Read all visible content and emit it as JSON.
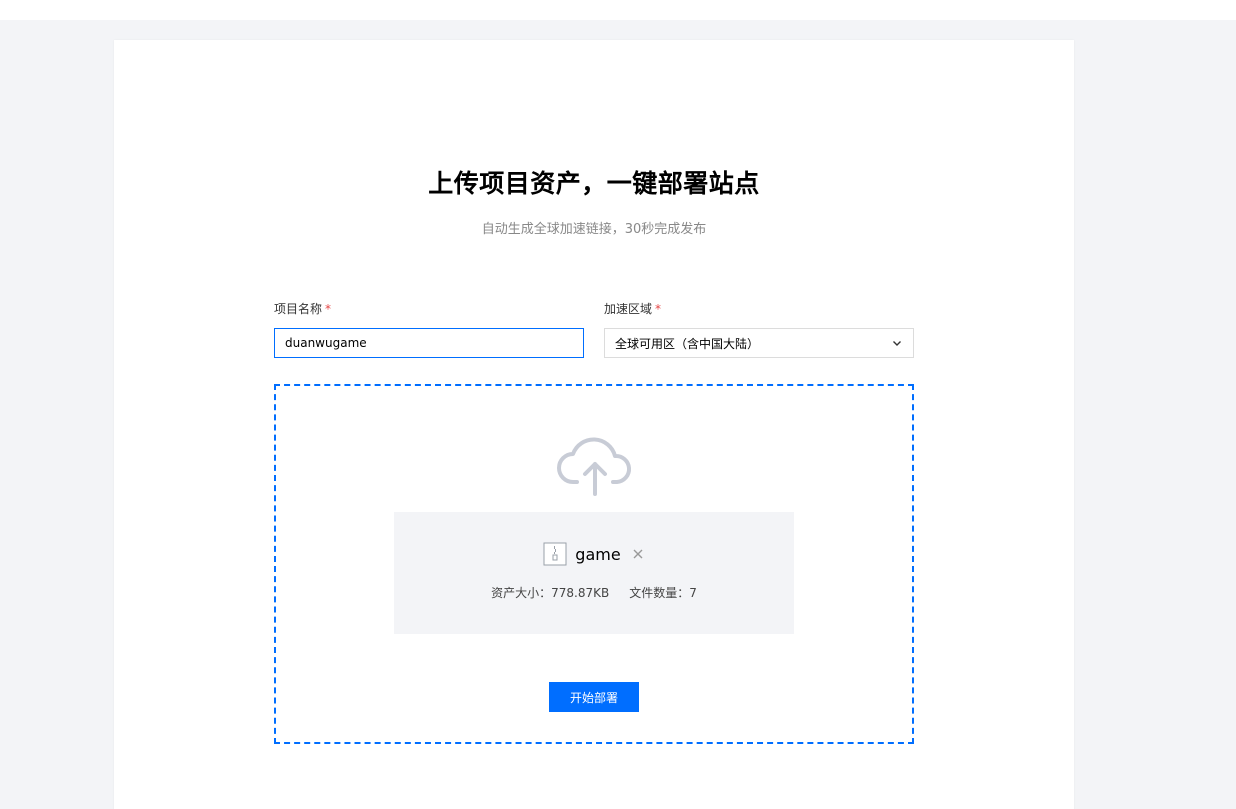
{
  "hero": {
    "title": "上传项目资产，一键部署站点",
    "subtitle": "自动生成全球加速链接，30秒完成发布"
  },
  "form": {
    "project_name_label": "项目名称",
    "project_name_value": "duanwugame",
    "region_label": "加速区域",
    "region_value": "全球可用区（含中国大陆）",
    "required_mark": "*"
  },
  "upload": {
    "file_name": "game",
    "size_text": "资产大小：778.87KB",
    "count_text": "文件数量：7",
    "deploy_label": "开始部署"
  },
  "colors": {
    "accent": "#006eff",
    "required": "#e54545",
    "panel_bg": "#f3f4f7"
  },
  "icons": [
    "cloud-upload-icon",
    "zip-file-icon",
    "close-icon",
    "chevron-down-icon"
  ]
}
